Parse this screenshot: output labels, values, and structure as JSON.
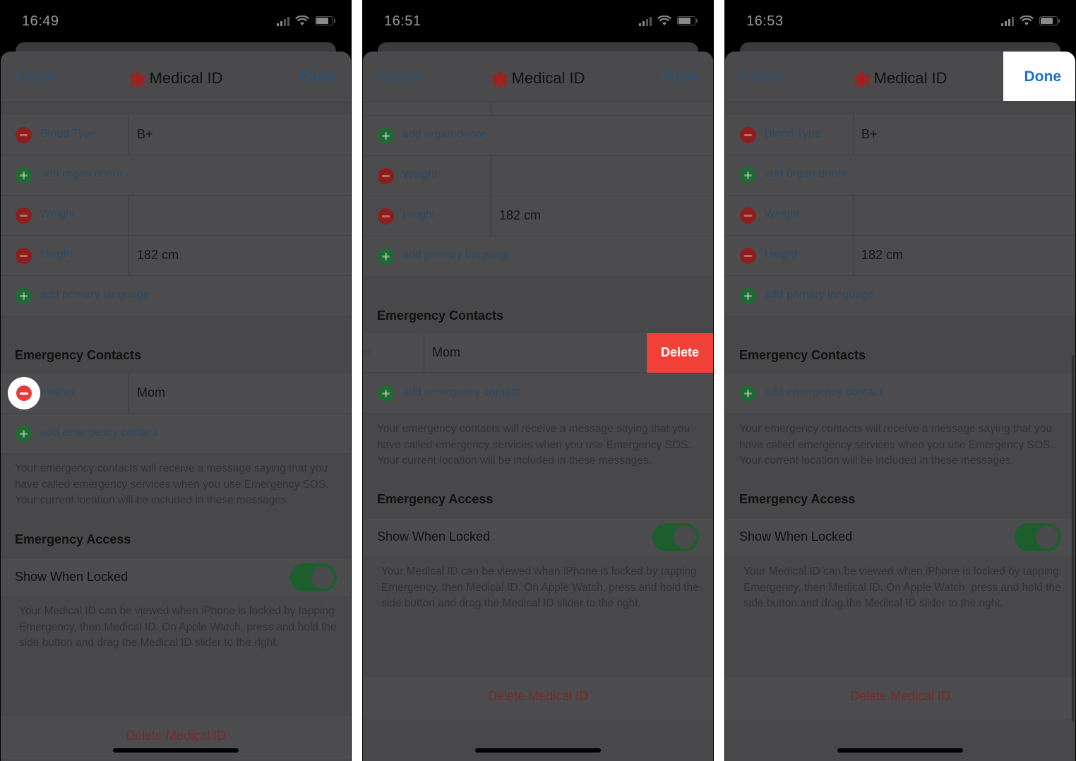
{
  "panels": [
    {
      "time": "16:49",
      "nav": {
        "cancel": "Cancel",
        "title": "Medical ID",
        "done": "Done"
      },
      "rows": [
        {
          "label": "Blood Type",
          "value": "B+",
          "type": "minus"
        },
        {
          "label": "add organ donor",
          "value": "",
          "type": "plus"
        },
        {
          "label": "Weight",
          "value": "",
          "type": "minus"
        },
        {
          "label": "Height",
          "value": "182 cm",
          "type": "minus"
        },
        {
          "label": "add primary language",
          "value": "",
          "type": "plus"
        }
      ],
      "emergency_contacts_header": "Emergency Contacts",
      "contacts": [
        {
          "relationship": "mother",
          "name": "Mom"
        }
      ],
      "add_contact": "add emergency contact",
      "contacts_note": "Your emergency contacts will receive a message saying that you have called emergency services when you use Emergency SOS. Your current location will be included in these messages.",
      "access_header": "Emergency Access",
      "show_when_locked": "Show When Locked",
      "show_when_locked_on": true,
      "access_note": "Your Medical ID can be viewed when iPhone is locked by tapping Emergency, then Medical ID. On Apple Watch, press and hold the side button and drag the Medical ID slider to the right.",
      "delete_medical_id": "Delete Medical ID"
    },
    {
      "time": "16:51",
      "nav": {
        "cancel": "Cancel",
        "title": "Medical ID",
        "done": "Done"
      },
      "rows": [
        {
          "label": "add organ donor",
          "value": "",
          "type": "plus"
        },
        {
          "label": "Weight",
          "value": "",
          "type": "minus"
        },
        {
          "label": "Height",
          "value": "182 cm",
          "type": "minus"
        },
        {
          "label": "add primary language",
          "value": "",
          "type": "plus"
        }
      ],
      "emergency_contacts_header": "Emergency Contacts",
      "contacts": [
        {
          "relationship": "er",
          "name": "Mom"
        }
      ],
      "swipe_delete": "Delete",
      "add_contact": "add emergency contact",
      "contacts_note": "Your emergency contacts will receive a message saying that you have called emergency services when you use Emergency SOS. Your current location will be included in these messages.",
      "access_header": "Emergency Access",
      "show_when_locked": "Show When Locked",
      "show_when_locked_on": true,
      "access_note": "Your Medical ID can be viewed when iPhone is locked by tapping Emergency, then Medical ID. On Apple Watch, press and hold the side button and drag the Medical ID slider to the right.",
      "delete_medical_id": "Delete Medical ID"
    },
    {
      "time": "16:53",
      "nav": {
        "cancel": "Cancel",
        "title": "Medical ID",
        "done": "Done"
      },
      "rows": [
        {
          "label": "Blood Type",
          "value": "B+",
          "type": "minus"
        },
        {
          "label": "add organ donor",
          "value": "",
          "type": "plus"
        },
        {
          "label": "Weight",
          "value": "",
          "type": "minus"
        },
        {
          "label": "Height",
          "value": "182 cm",
          "type": "minus"
        },
        {
          "label": "add primary language",
          "value": "",
          "type": "plus"
        }
      ],
      "emergency_contacts_header": "Emergency Contacts",
      "contacts": [],
      "add_contact": "add emergency contact",
      "contacts_note": "Your emergency contacts will receive a message saying that you have called emergency services when you use Emergency SOS. Your current location will be included in these messages.",
      "access_header": "Emergency Access",
      "show_when_locked": "Show When Locked",
      "show_when_locked_on": true,
      "access_note": "Your Medical ID can be viewed when iPhone is locked by tapping Emergency, then Medical ID. On Apple Watch, press and hold the side button and drag the Medical ID slider to the right.",
      "delete_medical_id": "Delete Medical ID"
    }
  ],
  "colors": {
    "accent_blue": "#1a73c8",
    "destructive_red": "#f04038",
    "toggle_green": "#34c759",
    "medical_star": "#e02020"
  }
}
